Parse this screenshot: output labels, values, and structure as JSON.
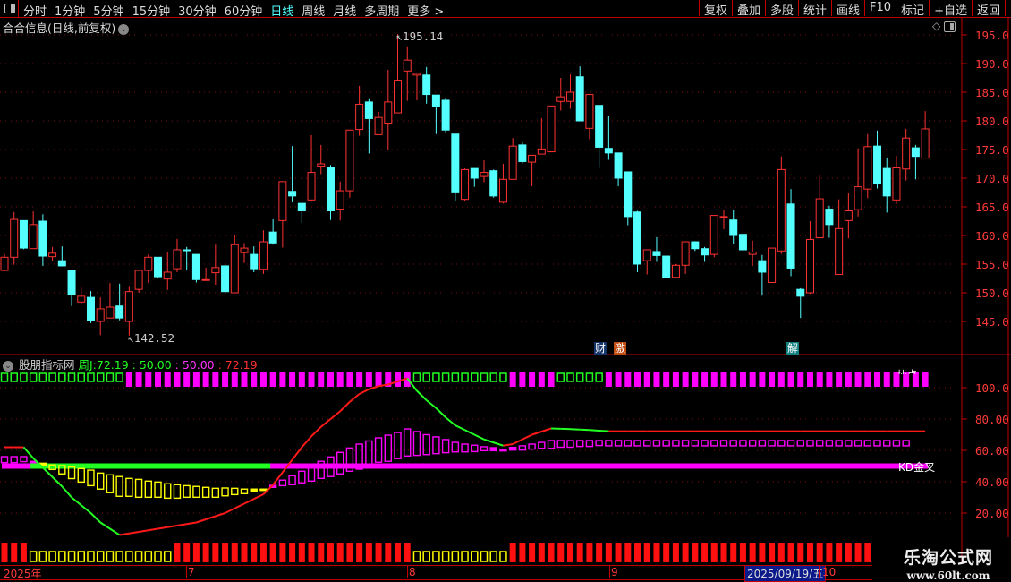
{
  "toolbar": {
    "periods": [
      "分时",
      "1分钟",
      "5分钟",
      "15分钟",
      "30分钟",
      "60分钟",
      "日线",
      "周线",
      "月线",
      "多周期",
      "更多 >"
    ],
    "active_period": "日线",
    "buttons": [
      "复权",
      "叠加",
      "多股",
      "统计",
      "画线",
      "F10",
      "标记",
      "+自选",
      "返回"
    ]
  },
  "main": {
    "title": "合合信息(日线,前复权)",
    "high_label": "195.14",
    "low_label": "142.52",
    "price_axis": [
      "195.0",
      "190.0",
      "185.0",
      "180.0",
      "175.0",
      "170.0",
      "165.0",
      "160.0",
      "155.0",
      "150.0",
      "145.0"
    ],
    "markers": [
      {
        "text": "财",
        "color": "#15356a"
      },
      {
        "text": "激",
        "color": "#c04a10"
      },
      {
        "text": "解",
        "color": "#138080"
      }
    ]
  },
  "indicator": {
    "name": "股朋指标网",
    "label_prefix": "周J:",
    "values": [
      "72.19",
      ": 50.00",
      ": 50.00",
      ": 72.19"
    ],
    "axis": [
      "100.0",
      "80.00",
      "60.00",
      "40.00",
      "20.00"
    ],
    "kd_label": "KD金叉",
    "top_right_label": "协点"
  },
  "date_axis": {
    "labels": [
      "2025年",
      "7",
      "8",
      "9",
      "10"
    ],
    "current_date": "2025/09/19/五"
  },
  "watermark": {
    "name": "乐淘公式网",
    "url": "www.60lt.com"
  },
  "colors": {
    "up": "#ff3232",
    "down": "#54ffff",
    "magenta": "#ff00ff",
    "green": "#22ff22",
    "yellow": "#ffff00",
    "grid": "#7a1010",
    "axis": "#c00000"
  },
  "chart_data": {
    "type": "candlestick",
    "ylim": [
      141,
      197
    ],
    "ohlc": [
      [
        153.9,
        156.8,
        153.75,
        156.2
      ],
      [
        156.2,
        164.1,
        154.9,
        162.8
      ],
      [
        162.6,
        162.6,
        157.6,
        157.8
      ],
      [
        157.7,
        164.2,
        157.7,
        161.9
      ],
      [
        162.5,
        163.7,
        154.7,
        156.4
      ],
      [
        156.3,
        158,
        155.6,
        156.9
      ],
      [
        155.6,
        158.1,
        154.6,
        154.7
      ],
      [
        153.9,
        153.9,
        147.7,
        149.7
      ],
      [
        148.4,
        151.1,
        148,
        149.4
      ],
      [
        149.2,
        150.3,
        144.7,
        145.2
      ],
      [
        145,
        149.2,
        142.6,
        147.2
      ],
      [
        145.6,
        151.7,
        145.6,
        147.5
      ],
      [
        147.7,
        151.6,
        145.2,
        145.6
      ],
      [
        145,
        151.2,
        142.52,
        150.2
      ],
      [
        150.6,
        154,
        150,
        153.9
      ],
      [
        153.9,
        156.7,
        151.7,
        156.2
      ],
      [
        156.2,
        156.2,
        152.6,
        152.8
      ],
      [
        152.4,
        157.2,
        150.5,
        153.6
      ],
      [
        154.2,
        159.4,
        153.6,
        157.5
      ],
      [
        157.5,
        158,
        153.9,
        157.4
      ],
      [
        156.7,
        156.7,
        151.8,
        152.3
      ],
      [
        152.2,
        154.4,
        152.1,
        152.3
      ],
      [
        153.5,
        158.4,
        151.4,
        154.4
      ],
      [
        154.7,
        154.8,
        150.2,
        150.2
      ],
      [
        150,
        160,
        150,
        158.4
      ],
      [
        157,
        158.7,
        155.2,
        157.8
      ],
      [
        156.7,
        158.1,
        153.6,
        154.2
      ],
      [
        154.1,
        160.9,
        153.3,
        158.9
      ],
      [
        160.6,
        162.8,
        158.4,
        158.7
      ],
      [
        162.6,
        169.4,
        157.9,
        169.4
      ],
      [
        167.7,
        175.6,
        165.8,
        166.9
      ],
      [
        165.6,
        165.6,
        162.2,
        164.3
      ],
      [
        166.2,
        177.5,
        165.9,
        171
      ],
      [
        172.1,
        175.8,
        170.7,
        172.5
      ],
      [
        171.9,
        172.3,
        162.7,
        164.3
      ],
      [
        164.6,
        169.4,
        162.6,
        167.8
      ],
      [
        167.8,
        178.4,
        166.6,
        178.4
      ],
      [
        178.5,
        186.1,
        177.4,
        182.9
      ],
      [
        183.3,
        183.8,
        174.3,
        180.4
      ],
      [
        177.6,
        181.6,
        177.6,
        180.6
      ],
      [
        179.6,
        188.9,
        175,
        183.3
      ],
      [
        181.4,
        195.14,
        181.4,
        187.1
      ],
      [
        188.7,
        193,
        183.5,
        190.6
      ],
      [
        188,
        188.4,
        183.6,
        188.3
      ],
      [
        188,
        189.4,
        183,
        184.6
      ],
      [
        184.5,
        184.5,
        177.7,
        182.5
      ],
      [
        183.6,
        184,
        178,
        178.4
      ],
      [
        177.7,
        177.7,
        166,
        167.6
      ],
      [
        166.3,
        171.7,
        166,
        171.5
      ],
      [
        171.7,
        171.7,
        168.5,
        170
      ],
      [
        170.3,
        173.1,
        169.3,
        171
      ],
      [
        171.3,
        171.5,
        166.6,
        166.9
      ],
      [
        165.8,
        172.5,
        165.6,
        169.8
      ],
      [
        169.8,
        177,
        169.8,
        175.6
      ],
      [
        175.8,
        176.3,
        172.6,
        172.9
      ],
      [
        172.8,
        174,
        168.6,
        174
      ],
      [
        174.2,
        180.5,
        174.2,
        175.1
      ],
      [
        174.6,
        182.6,
        174.6,
        182.6
      ],
      [
        183.4,
        187.5,
        181.8,
        184.2
      ],
      [
        183.4,
        188.1,
        182.1,
        185
      ],
      [
        187.7,
        189.5,
        180,
        180
      ],
      [
        178.7,
        184.6,
        176.8,
        184.6
      ],
      [
        182.7,
        182.7,
        171.8,
        175.4
      ],
      [
        175.2,
        180.9,
        173.2,
        174.4
      ],
      [
        174.4,
        174.4,
        168.6,
        170
      ],
      [
        171.1,
        171.1,
        161.8,
        163.3
      ],
      [
        164.1,
        164.3,
        153.6,
        155
      ],
      [
        155.6,
        157.5,
        153.2,
        157.5
      ],
      [
        157.2,
        159.7,
        155.4,
        156.5
      ],
      [
        156.4,
        156.4,
        152.5,
        152.7
      ],
      [
        152.7,
        155,
        152.6,
        154.8
      ],
      [
        154.8,
        158.9,
        153.3,
        158.9
      ],
      [
        158.9,
        159,
        157.3,
        157.7
      ],
      [
        157.7,
        158,
        155.4,
        156.6
      ],
      [
        156.7,
        163.5,
        156.2,
        163.5
      ],
      [
        163.3,
        164.4,
        161.1,
        163.3
      ],
      [
        162.7,
        164.4,
        158.6,
        160
      ],
      [
        160.2,
        160.7,
        157.2,
        157.5
      ],
      [
        156.7,
        159.1,
        154.7,
        157.1
      ],
      [
        155.6,
        156.6,
        149.5,
        153.6
      ],
      [
        151.8,
        157.8,
        151.8,
        157.8
      ],
      [
        157.3,
        173.8,
        156.8,
        171.5
      ],
      [
        165.5,
        168.1,
        152.9,
        154.3
      ],
      [
        150.6,
        150.8,
        145.6,
        149.4
      ],
      [
        150,
        162.5,
        149.8,
        159.3
      ],
      [
        159.6,
        170.5,
        159.6,
        166.4
      ],
      [
        164.6,
        165.2,
        159.6,
        161.9
      ],
      [
        153.2,
        166.3,
        153.2,
        161.2
      ],
      [
        162.6,
        167.5,
        159.5,
        164.3
      ],
      [
        164.5,
        175.2,
        163.3,
        168.5
      ],
      [
        168.1,
        177.7,
        166.5,
        175.5
      ],
      [
        175.6,
        178.3,
        168.2,
        169
      ],
      [
        171.7,
        173.6,
        164,
        166.9
      ],
      [
        166.2,
        173.9,
        165.5,
        171.8
      ],
      [
        171.6,
        178.6,
        169.6,
        177
      ],
      [
        175.3,
        175.8,
        169.8,
        173.8
      ],
      [
        173.5,
        181.7,
        173.5,
        178.6
      ]
    ],
    "indicator": {
      "ylim": [
        0,
        110
      ],
      "j_line": [
        62,
        62,
        62,
        55,
        49,
        43,
        37,
        30,
        25,
        20,
        14,
        10,
        6,
        7,
        8,
        9,
        10,
        11,
        12,
        13,
        14,
        16,
        18,
        20,
        23,
        26,
        29,
        32,
        38,
        46,
        54,
        62,
        69,
        75,
        80,
        85,
        91,
        96,
        99,
        101,
        102,
        104,
        106,
        98,
        92,
        87,
        81,
        76,
        73,
        70,
        67,
        65,
        63,
        64,
        67,
        70,
        72,
        74,
        73.8,
        73.6,
        73.3,
        73,
        72.6,
        72.19,
        72.19,
        72.19,
        72.19,
        72.19,
        72.19,
        72.19,
        72.19,
        72.19,
        72.19,
        72.19,
        72.19,
        72.19,
        72.19,
        72.19,
        72.19,
        72.19,
        72.19,
        72.19,
        72.19,
        72.19,
        72.19,
        72.19,
        72.19,
        72.19,
        72.19,
        72.19,
        72.19,
        72.19,
        72.19,
        72.19,
        72.19,
        72.19,
        72.19
      ],
      "level_line": 50,
      "level_segments": [
        {
          "from": 0,
          "to": 3,
          "color": "magenta"
        },
        {
          "from": 3,
          "to": 28,
          "color": "green"
        },
        {
          "from": 28,
          "to": 96,
          "color": "magenta"
        }
      ],
      "osc_bars": [
        [
          56,
          52.2
        ],
        [
          56,
          52.2
        ],
        [
          56,
          52.8
        ],
        [
          53,
          52.2
        ],
        [
          51.8,
          50.7
        ],
        [
          50.7,
          47.8
        ],
        [
          50.3,
          45
        ],
        [
          49.5,
          42
        ],
        [
          48.4,
          39.8
        ],
        [
          47.4,
          37.5
        ],
        [
          45.5,
          35.3
        ],
        [
          44.4,
          33
        ],
        [
          43.3,
          30.7
        ],
        [
          42.1,
          30.7
        ],
        [
          41.5,
          30.1
        ],
        [
          40.4,
          30.1
        ],
        [
          39.8,
          30.1
        ],
        [
          38.7,
          29.5
        ],
        [
          38.1,
          29.5
        ],
        [
          37.5,
          30.1
        ],
        [
          37,
          30.1
        ],
        [
          36.4,
          30.1
        ],
        [
          35.8,
          30.1
        ],
        [
          36,
          31
        ],
        [
          35.8,
          31.8
        ],
        [
          35.3,
          32.4
        ],
        [
          35.3,
          33.6
        ],
        [
          35.3,
          34.7
        ],
        [
          37.7,
          36.4
        ],
        [
          41,
          37.5
        ],
        [
          43.8,
          38.1
        ],
        [
          46.7,
          39.3
        ],
        [
          49.9,
          40.4
        ],
        [
          53,
          42.1
        ],
        [
          55.8,
          43.3
        ],
        [
          58.7,
          45
        ],
        [
          61.5,
          46.7
        ],
        [
          64,
          48
        ],
        [
          66,
          50
        ],
        [
          68,
          52.4
        ],
        [
          69.7,
          53
        ],
        [
          71.4,
          54.7
        ],
        [
          73.7,
          56.4
        ],
        [
          72,
          56.8
        ],
        [
          70,
          57.3
        ],
        [
          68.6,
          57.9
        ],
        [
          66.9,
          58.5
        ],
        [
          65.1,
          59
        ],
        [
          64,
          59
        ],
        [
          63.3,
          59.2
        ],
        [
          62.3,
          59.8
        ],
        [
          61.7,
          59.8
        ],
        [
          60.6,
          59.6
        ],
        [
          61.9,
          60.2
        ],
        [
          62.9,
          60.2
        ],
        [
          64,
          60.8
        ],
        [
          65.1,
          61.3
        ],
        [
          66.3,
          61.3
        ],
        [
          66.3,
          62
        ],
        [
          66.3,
          62
        ],
        [
          66.3,
          62.5
        ],
        [
          66.3,
          62.5
        ],
        [
          66.3,
          63.1
        ],
        [
          66.3,
          62.9
        ],
        [
          66.3,
          62.9
        ],
        [
          66.3,
          62.9
        ],
        [
          66.3,
          62.9
        ],
        [
          66.3,
          62.9
        ],
        [
          66.3,
          62.9
        ],
        [
          66.3,
          62.9
        ],
        [
          66.3,
          62.9
        ],
        [
          66.3,
          62.9
        ],
        [
          66.3,
          62.9
        ],
        [
          66.3,
          62.9
        ],
        [
          66.3,
          62.9
        ],
        [
          66.3,
          62.9
        ],
        [
          66.3,
          62.9
        ],
        [
          66.3,
          62.9
        ],
        [
          66.3,
          62.9
        ],
        [
          66.3,
          62.9
        ],
        [
          66.3,
          62.9
        ],
        [
          66.3,
          62.9
        ],
        [
          66.3,
          62.9
        ],
        [
          66.3,
          62.9
        ],
        [
          66.3,
          62.9
        ],
        [
          66.3,
          62.9
        ],
        [
          66.3,
          62.9
        ],
        [
          66.3,
          62.9
        ],
        [
          66.3,
          62.9
        ],
        [
          66.3,
          62.9
        ],
        [
          66.3,
          62.9
        ],
        [
          66.3,
          62.9
        ],
        [
          66.3,
          62.9
        ],
        [
          66.3,
          62.9
        ],
        [
          66.3,
          62.9
        ]
      ],
      "osc_segments": [
        {
          "from": 0,
          "to": 3,
          "color": "magenta"
        },
        {
          "from": 4,
          "to": 27,
          "color": "yellow"
        },
        {
          "from": 28,
          "to": 96,
          "color": "magenta"
        }
      ],
      "top_row": [
        {
          "from": 0,
          "to": 12,
          "color": "green"
        },
        {
          "from": 13,
          "to": 42,
          "color": "magenta"
        },
        {
          "from": 43,
          "to": 52,
          "color": "green"
        },
        {
          "from": 53,
          "to": 57,
          "color": "magenta"
        },
        {
          "from": 58,
          "to": 62,
          "color": "green"
        },
        {
          "from": 63,
          "to": 96,
          "color": "magenta"
        }
      ],
      "bottom_row": [
        {
          "from": 0,
          "to": 2,
          "color": "red"
        },
        {
          "from": 3,
          "to": 17,
          "color": "yellow"
        },
        {
          "from": 18,
          "to": 42,
          "color": "red"
        },
        {
          "from": 43,
          "to": 52,
          "color": "yellow"
        },
        {
          "from": 53,
          "to": 90,
          "color": "red"
        }
      ]
    }
  }
}
